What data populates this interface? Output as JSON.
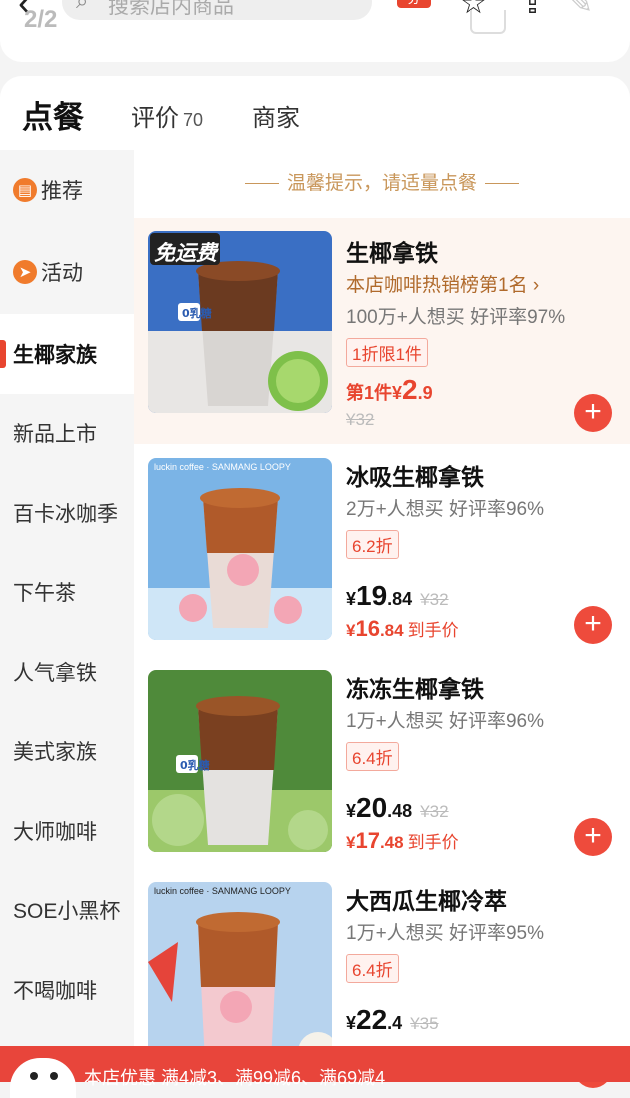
{
  "topbar": {
    "page_indicator": "2/2",
    "search_placeholder": "搜索店内商品",
    "tag": "券"
  },
  "tabs": {
    "order": "点餐",
    "review": "评价",
    "review_count": "70",
    "shop": "商家"
  },
  "sidebar": {
    "items": [
      {
        "label": "推荐"
      },
      {
        "label": "活动"
      },
      {
        "label": "生椰家族"
      },
      {
        "label": "新品上市"
      },
      {
        "label": "百卡冰咖季"
      },
      {
        "label": "下午茶"
      },
      {
        "label": "人气拿铁"
      },
      {
        "label": "美式家族"
      },
      {
        "label": "大师咖啡"
      },
      {
        "label": "SOE小黑杯"
      },
      {
        "label": "不喝咖啡"
      }
    ]
  },
  "content": {
    "tip": "温馨提示，请适量点餐",
    "products": [
      {
        "name": "生椰拿铁",
        "rank": "本店咖啡热销榜第1名 ›",
        "stats": "100万+人想买 好评率97%",
        "badge": "1折限1件",
        "first_label": "第1件",
        "currency": "¥",
        "first_price_int": "2",
        "first_price_dec": ".9",
        "orig": "¥32",
        "img_tag": "免运费",
        "img_sugar": "0乳糖"
      },
      {
        "name": "冰吸生椰拿铁",
        "stats": "2万+人想买 好评率96%",
        "badge": "6.2折",
        "currency": "¥",
        "price_int": "19",
        "price_dec": ".84",
        "orig": "¥32",
        "final_int": "16",
        "final_dec": ".84",
        "final_note": "到手价",
        "img_brand": "luckin coffee · SANMANG LOOPY"
      },
      {
        "name": "冻冻生椰拿铁",
        "stats": "1万+人想买 好评率96%",
        "badge": "6.4折",
        "currency": "¥",
        "price_int": "20",
        "price_dec": ".48",
        "orig": "¥32",
        "final_int": "17",
        "final_dec": ".48",
        "final_note": "到手价",
        "img_sugar": "0乳糖"
      },
      {
        "name": "大西瓜生椰冷萃",
        "stats": "1万+人想买 好评率95%",
        "badge": "6.4折",
        "currency": "¥",
        "price_int": "22",
        "price_dec": ".4",
        "orig": "¥35",
        "img_brand": "luckin coffee · SANMANG LOOPY"
      }
    ]
  },
  "banner": {
    "text": "本店优惠  满4减3、满99减6、满69减4"
  },
  "colors": {
    "accent_red": "#e8452f",
    "gold_text": "#c9975b",
    "highlight_bg": "#fdf5f0"
  }
}
